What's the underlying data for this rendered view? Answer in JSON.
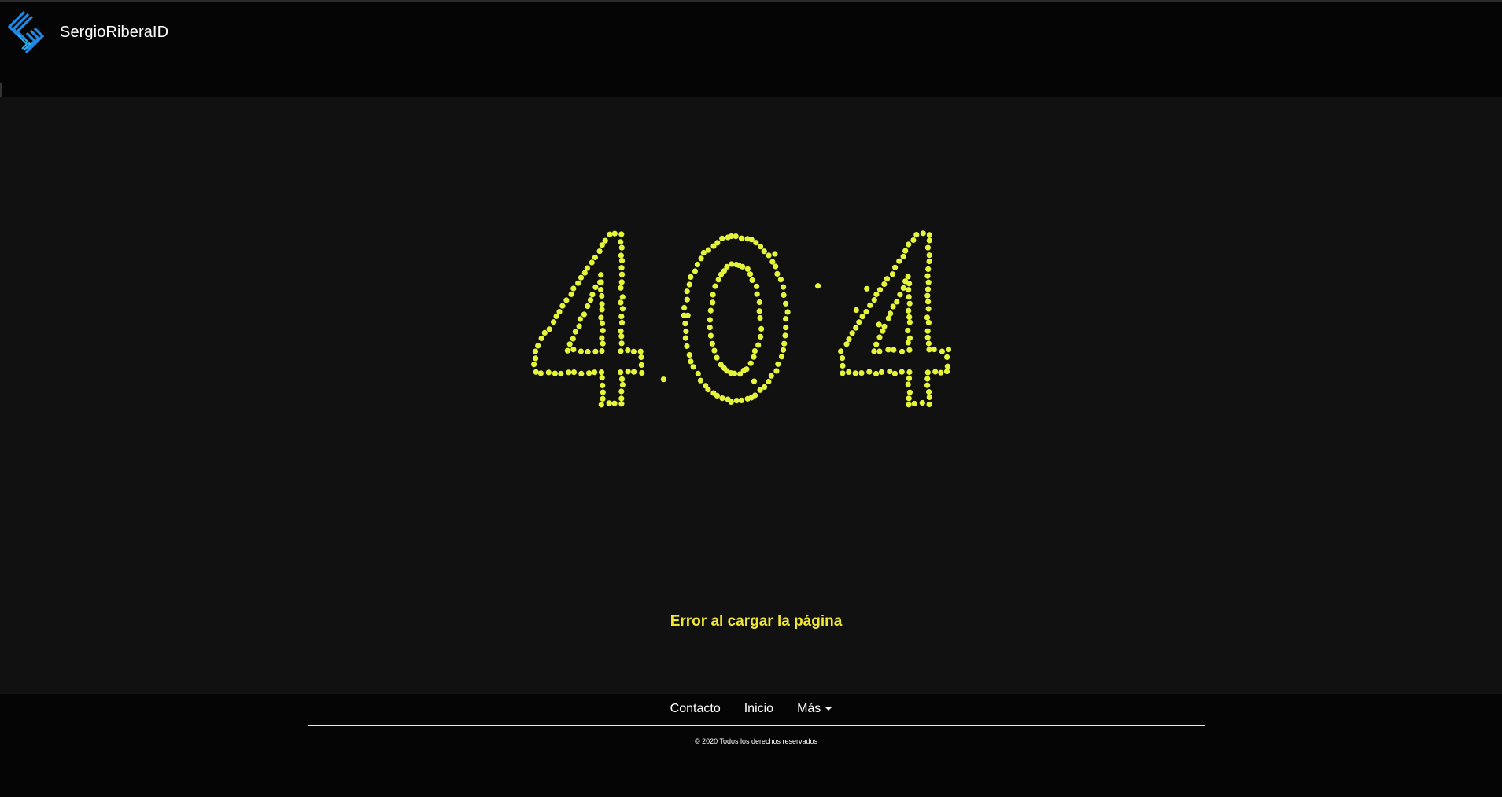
{
  "header": {
    "brand_name": "SergioRiberaID",
    "logo_icon": "sr-diamond-logo-icon",
    "logo_color": "#1e88e5"
  },
  "main": {
    "code": "404",
    "code_color": "#e4f53a",
    "message": "Error al cargar la página",
    "message_color": "#f0e634"
  },
  "footer": {
    "links": [
      {
        "label": "Contacto"
      },
      {
        "label": "Inicio"
      },
      {
        "label": "Más",
        "icon": "caret-down-icon"
      }
    ],
    "copyright": "© 2020 Todos los derechos reservados"
  }
}
